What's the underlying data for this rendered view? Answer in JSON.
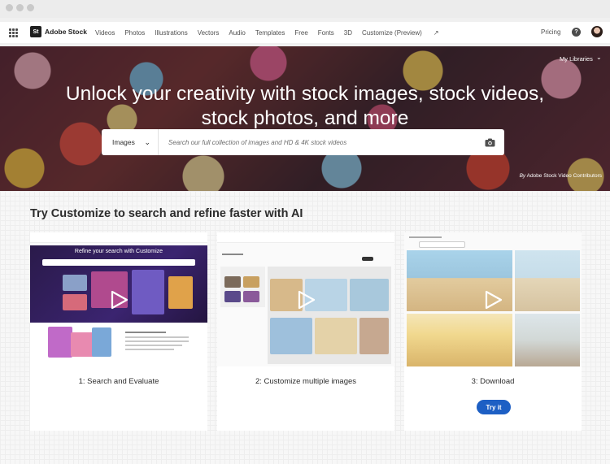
{
  "nav": {
    "logo_short": "St",
    "brand": "Adobe Stock",
    "items": [
      "Videos",
      "Photos",
      "Illustrations",
      "Vectors",
      "Audio",
      "Templates",
      "Free",
      "Fonts",
      "3D",
      "Customize (Preview)"
    ],
    "pricing": "Pricing",
    "help_icon": "help-icon"
  },
  "hero": {
    "my_libraries": "My Libraries",
    "title_line1": "Unlock your creativity with stock images, stock videos,",
    "title_line2": "stock photos, and more",
    "search_type": "Images",
    "search_placeholder": "Search our full collection of images and HD & 4K stock videos",
    "credit_prefix": "By",
    "credit": "Adobe Stock Video Contributors"
  },
  "section": {
    "title": "Try Customize to search and refine faster with AI",
    "cards": [
      {
        "label": "1: Search and Evaluate",
        "mock_title": "Refine your search with Customize"
      },
      {
        "label": "2: Customize multiple images"
      },
      {
        "label": "3: Download",
        "button": "Try it"
      }
    ]
  },
  "colors": {
    "accent": "#1d5fc4",
    "nav_bg": "#ffffff",
    "section_bg": "#f7f7f7"
  }
}
